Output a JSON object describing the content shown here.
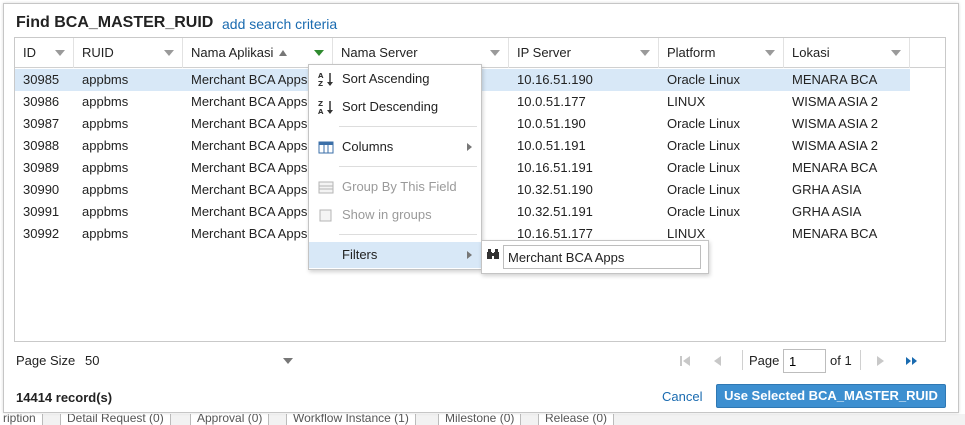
{
  "background_tabs": [
    "ription",
    "Detail Request (0)",
    "Approval (0)",
    "Workflow Instance (1)",
    "Milestone (0)",
    "Release (0)"
  ],
  "dialog": {
    "title": "Find BCA_MASTER_RUID",
    "add_search_criteria": "add search criteria"
  },
  "grid": {
    "columns": [
      "ID",
      "RUID",
      "Nama Aplikasi",
      "Nama Server",
      "IP Server",
      "Platform",
      "Lokasi"
    ],
    "sorted_column": "Nama Aplikasi",
    "sort_direction": "ascending",
    "filtered_column": "Nama Aplikasi",
    "rows": [
      {
        "id": "30985",
        "ruid": "appbms",
        "nama_aplikasi": "Merchant BCA Apps",
        "ip_server": "10.16.51.190",
        "platform": "Oracle Linux",
        "lokasi": "MENARA BCA"
      },
      {
        "id": "30986",
        "ruid": "appbms",
        "nama_aplikasi": "Merchant BCA Apps",
        "ip_server": "10.0.51.177",
        "platform": "LINUX",
        "lokasi": "WISMA ASIA 2"
      },
      {
        "id": "30987",
        "ruid": "appbms",
        "nama_aplikasi": "Merchant BCA Apps",
        "ip_server": "10.0.51.190",
        "platform": "Oracle Linux",
        "lokasi": "WISMA ASIA 2"
      },
      {
        "id": "30988",
        "ruid": "appbms",
        "nama_aplikasi": "Merchant BCA Apps",
        "ip_server": "10.0.51.191",
        "platform": "Oracle Linux",
        "lokasi": "WISMA ASIA 2"
      },
      {
        "id": "30989",
        "ruid": "appbms",
        "nama_aplikasi": "Merchant BCA Apps",
        "ip_server": "10.16.51.191",
        "platform": "Oracle Linux",
        "lokasi": "MENARA BCA"
      },
      {
        "id": "30990",
        "ruid": "appbms",
        "nama_aplikasi": "Merchant BCA Apps",
        "ip_server": "10.32.51.190",
        "platform": "Oracle Linux",
        "lokasi": "GRHA ASIA"
      },
      {
        "id": "30991",
        "ruid": "appbms",
        "nama_aplikasi": "Merchant BCA Apps",
        "ip_server": "10.32.51.191",
        "platform": "Oracle Linux",
        "lokasi": "GRHA ASIA"
      },
      {
        "id": "30992",
        "ruid": "appbms",
        "nama_aplikasi": "Merchant BCA Apps",
        "ip_server": "10.16.51.177",
        "platform": "LINUX",
        "lokasi": "MENARA BCA"
      }
    ]
  },
  "context_menu": {
    "items": [
      {
        "label": "Sort Ascending",
        "icon": "sort-ascending-icon",
        "enabled": true
      },
      {
        "label": "Sort Descending",
        "icon": "sort-descending-icon",
        "enabled": true
      },
      {
        "label": "Columns",
        "icon": "columns-icon",
        "enabled": true,
        "submenu": true
      },
      {
        "label": "Group By This Field",
        "icon": "group-by-icon",
        "enabled": false
      },
      {
        "label": "Show in groups",
        "icon": "checkbox-icon",
        "enabled": false
      },
      {
        "label": "Filters",
        "icon": "",
        "enabled": true,
        "submenu": true,
        "highlighted": true
      }
    ],
    "filter_value": "Merchant BCA Apps"
  },
  "footer": {
    "page_size_label": "Page Size",
    "page_size": "50",
    "page_label": "Page",
    "page_number": "1",
    "page_of": "of 1",
    "records": "14414 record(s)",
    "cancel": "Cancel",
    "use_selected": "Use Selected BCA_MASTER_RUID"
  },
  "colors": {
    "accent": "#3d8fd0",
    "link": "#1a6bb0",
    "selection": "#d8e8f7",
    "active_filter": "#2f8a2f"
  }
}
